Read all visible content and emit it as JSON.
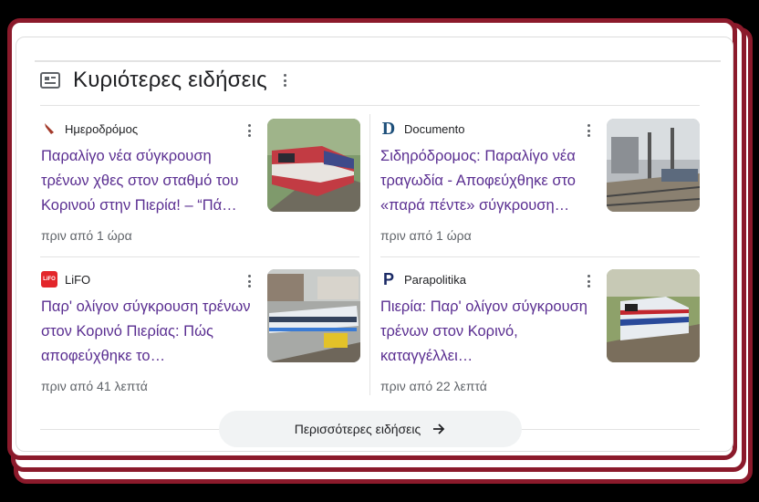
{
  "section": {
    "title": "Κυριότερες ειδήσεις"
  },
  "articles": [
    {
      "source": "Ημεροδρόμος",
      "headline": "Παραλίγο νέα σύγκρουση τρένων χθες στον σταθμό του Κορινού στην Πιερία! – “Πά…",
      "time": "πριν από 1 ώρα"
    },
    {
      "source": "Documento",
      "logo_text": "D",
      "headline": "Σιδηρόδρομος: Παραλίγο νέα τραγωδία - Αποφεύχθηκε στο «παρά πέντε» σύγκρουση…",
      "time": "πριν από 1 ώρα"
    },
    {
      "source": "LiFO",
      "logo_text": "LiFO",
      "headline": "Παρ' ολίγον σύγκρουση τρένων στον Κορινό Πιερίας: Πώς αποφεύχθηκε το…",
      "time": "πριν από 41 λεπτά"
    },
    {
      "source": "Parapolitika",
      "logo_text": "P",
      "headline": "Πιερία: Παρ' ολίγον σύγκρουση τρένων στον Κορινό, καταγγέλλει…",
      "time": "πριν από 22 λεπτά"
    }
  ],
  "more_button": {
    "label": "Περισσότερες ειδήσεις"
  },
  "colors": {
    "frame": "#8b1a2b",
    "headline": "#5a2e91",
    "meta": "#5f6368",
    "button_bg": "#f1f3f4"
  },
  "icons": [
    "news-icon",
    "more-vert-icon",
    "arrow-right-icon"
  ]
}
